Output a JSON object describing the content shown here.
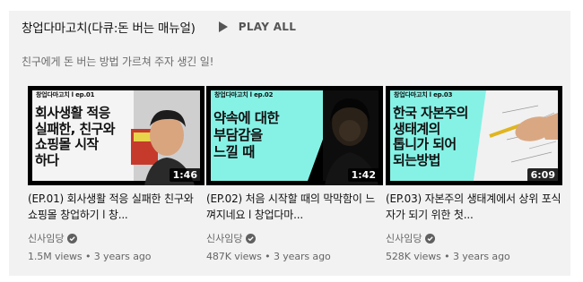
{
  "shelf": {
    "title": "창업다마고치(다큐:돈 버는 매뉴얼)",
    "play_all_label": "PLAY ALL",
    "description": "친구에게 돈 버는 방법 가르쳐 주자 생긴 일!"
  },
  "videos": [
    {
      "thumb_tag": "창업다마고치 l ep.01",
      "thumb_headline": "회사생활 적응\n실패한, 친구와\n쇼핑몰 시작\n하다",
      "thumb_bg": "#f4f4f4",
      "duration": "1:46",
      "title": "(EP.01) 회사생활 적응 실패한 친구와 쇼핑몰 창업하기 l 창...",
      "channel": "신사임당",
      "views": "1.5M views",
      "age": "3 years ago"
    },
    {
      "thumb_tag": "창업다마고치 l ep.02",
      "thumb_headline": "약속에 대한\n부담감을\n느낄 때",
      "thumb_bg": "#86f2e6",
      "duration": "1:42",
      "title": "(EP.02) 처음 시작할 때의 막막함이 느껴지네요 l 창업다마...",
      "channel": "신사임당",
      "views": "487K views",
      "age": "3 years ago"
    },
    {
      "thumb_tag": "창업다마고치 l ep.03",
      "thumb_headline": "한국 자본주의\n생태계의\n톱니가 되어\n되는방법",
      "thumb_bg": "#86f2e6",
      "duration": "6:09",
      "title": "(EP.03) 자본주의 생태계에서 상위 포식자가 되기 위한 첫...",
      "channel": "신사임당",
      "views": "528K views",
      "age": "3 years ago"
    }
  ]
}
